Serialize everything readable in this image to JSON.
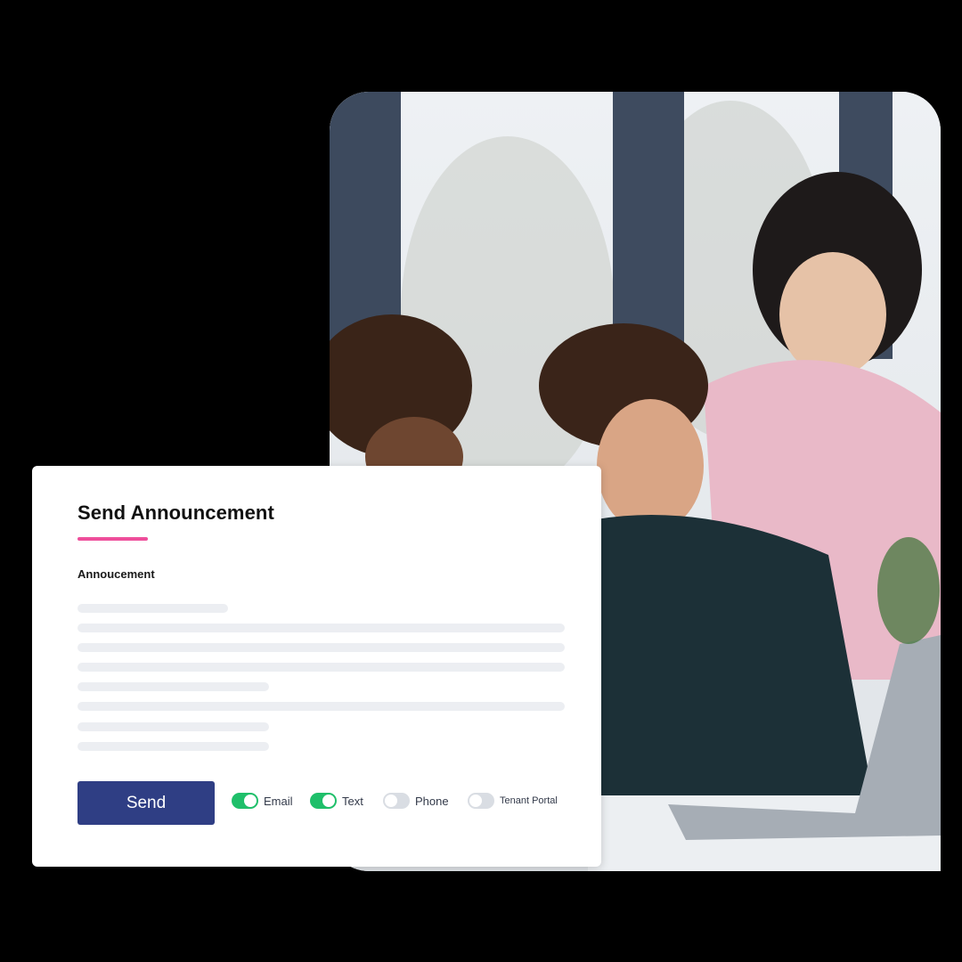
{
  "card": {
    "title": "Send Announcement",
    "field_label": "Annoucement",
    "send_label": "Send",
    "channels": [
      {
        "label": "Email",
        "enabled": true
      },
      {
        "label": "Text",
        "enabled": true
      },
      {
        "label": "Phone",
        "enabled": false
      },
      {
        "label": "Tenant Portal",
        "enabled": false
      }
    ]
  },
  "colors": {
    "accent": "#ee4e9b",
    "primary_button": "#2f3e84",
    "toggle_on": "#1fbf6a",
    "toggle_off": "#d9dde3"
  }
}
